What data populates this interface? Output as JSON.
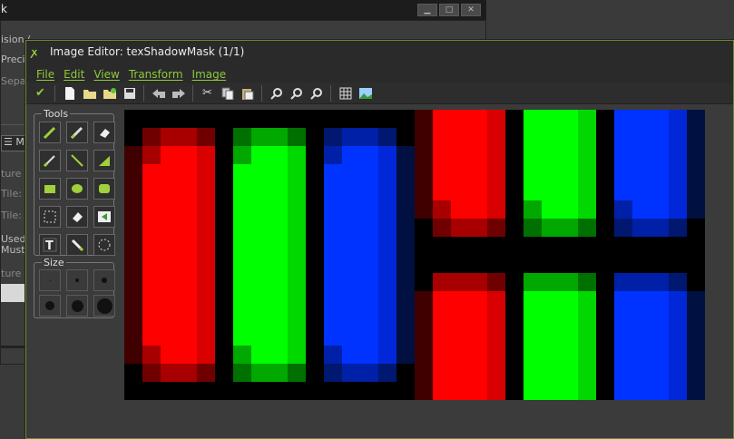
{
  "bg_window": {
    "title": "k",
    "lines": [
      {
        "text": "ision (",
        "dim": false
      },
      {
        "text": "Precis",
        "dim": false
      },
      {
        "text": "Separ",
        "dim": true
      },
      {
        "text": "Mo",
        "dim": false
      },
      {
        "text": "ture S",
        "dim": true
      },
      {
        "text": "Tile: H",
        "dim": true
      },
      {
        "text": "Tile: V",
        "dim": true
      },
      {
        "text": "Used",
        "dim": false
      },
      {
        "text": "Must",
        "dim": false
      },
      {
        "text": "ture G",
        "dim": true
      }
    ]
  },
  "editor": {
    "title": "Image Editor: texShadowMask (1/1)",
    "menus": [
      "File",
      "Edit",
      "View",
      "Transform",
      "Image"
    ],
    "toolbar": [
      "apply-icon",
      "new-icon",
      "open-icon",
      "open-green-icon",
      "save-icon",
      "undo-icon",
      "redo-icon",
      "cut-icon",
      "copy-icon",
      "paste-icon",
      "zoom-out-icon",
      "zoom-in-icon",
      "zoom-reset-icon",
      "grid-icon",
      "image-icon"
    ],
    "tools_title": "Tools",
    "tools": [
      "pencil-icon",
      "brush-icon",
      "eraser-icon",
      "line-pen-icon",
      "line-icon",
      "fill-tri-icon",
      "rect-icon",
      "ellipse-icon",
      "roundrect-icon",
      "select-rect-icon",
      "eraser-select-icon",
      "anchor-icon",
      "text-icon",
      "eyedropper-icon",
      "select-ellipse-icon"
    ],
    "size_title": "Size",
    "sizes": [
      1,
      3,
      5,
      8,
      11,
      14
    ]
  },
  "colors": {
    "accent_green": "#8fc93a",
    "red": "#ff0000",
    "green": "#00ff00",
    "blue": "#0033ff"
  }
}
